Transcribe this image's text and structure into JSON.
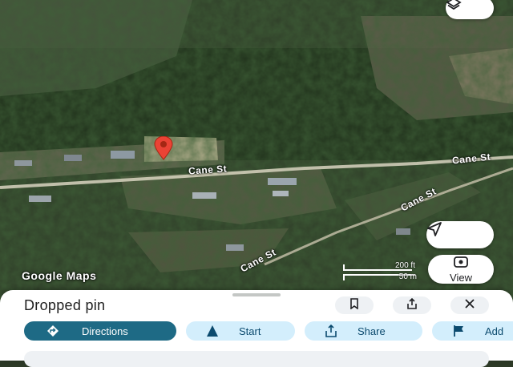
{
  "map": {
    "watermark": "Google Maps",
    "roads": [
      "Cane St",
      "Cane St",
      "Cane St",
      "Cane St"
    ],
    "scale": {
      "imperial": "200 ft",
      "metric": "50 m"
    },
    "pin_color": "#ea4335",
    "icons": {
      "layers": "layers-icon",
      "navigate": "navigation-arrow-icon",
      "view": "street-view-icon"
    },
    "view_label": "View"
  },
  "place": {
    "title": "Dropped pin",
    "actions": [
      "bookmark-icon",
      "share-icon",
      "close-icon"
    ]
  },
  "chips": [
    {
      "label": "Directions",
      "icon": "directions-icon"
    },
    {
      "label": "Start",
      "icon": "navigation-icon"
    },
    {
      "label": "Share",
      "icon": "share-icon"
    },
    {
      "label": "Add",
      "icon": "flag-icon"
    }
  ],
  "colors": {
    "primary": "#1e6a85",
    "chip": "#d3eefc",
    "chip_text": "#0b4a6e"
  }
}
